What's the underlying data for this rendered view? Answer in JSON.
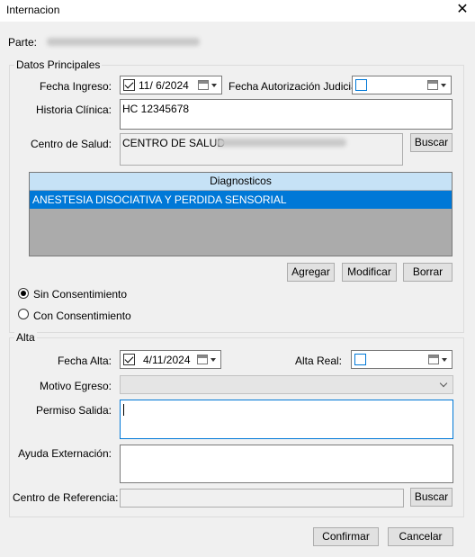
{
  "window": {
    "title": "Internacion",
    "close_glyph": "✕"
  },
  "parte": {
    "label": "Parte:"
  },
  "datos_principales": {
    "legend": "Datos Principales",
    "fecha_ingreso_label": "Fecha Ingreso:",
    "fecha_ingreso_value": "11/ 6/2024",
    "fecha_autorizacion_label": "Fecha Autorización Judicial:",
    "historia_label": "Historia Clínica:",
    "historia_value": "HC 12345678",
    "centro_label": "Centro de Salud:",
    "centro_value": "CENTRO DE SALUD",
    "buscar_label": "Buscar",
    "diagnosticos_header": "Diagnosticos",
    "diagnosticos_rows": [
      "ANESTESIA DISOCIATIVA Y PERDIDA SENSORIAL"
    ],
    "agregar_label": "Agregar",
    "modificar_label": "Modificar",
    "borrar_label": "Borrar"
  },
  "consentimiento": {
    "sin_label": "Sin Consentimiento",
    "con_label": "Con Consentimiento",
    "selected": "sin"
  },
  "alta": {
    "legend": "Alta",
    "fecha_alta_label": "Fecha Alta:",
    "fecha_alta_value": "4/11/2024",
    "alta_real_label": "Alta Real:",
    "motivo_label": "Motivo Egreso:",
    "motivo_value": "",
    "permiso_label": "Permiso Salida:",
    "ayuda_label": "Ayuda Externación:",
    "centro_ref_label": "Centro de Referencia:",
    "buscar_label": "Buscar"
  },
  "footer": {
    "confirmar_label": "Confirmar",
    "cancelar_label": "Cancelar"
  },
  "colors": {
    "selection": "#0078d7",
    "grid_header": "#c6e2f6",
    "grid_bg": "#ababab",
    "dialog_bg": "#f0f0f0"
  }
}
